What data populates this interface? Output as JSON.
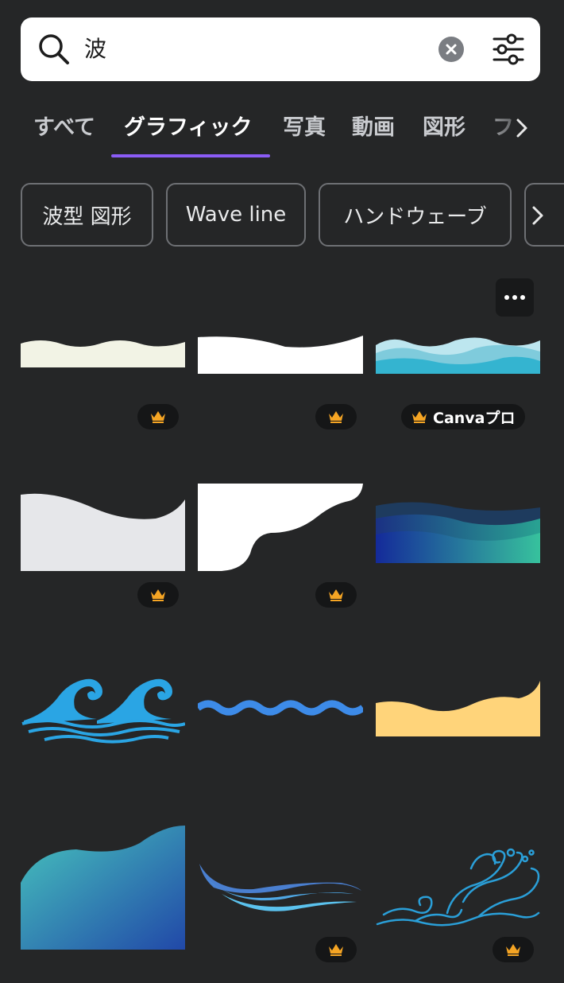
{
  "search": {
    "query": "波",
    "icons": {
      "search": "search-icon",
      "clear": "clear-icon",
      "filter": "filter-sliders-icon"
    }
  },
  "tabs": [
    {
      "label": "すべて",
      "active": false
    },
    {
      "label": "グラフィック",
      "active": true
    },
    {
      "label": "写真",
      "active": false
    },
    {
      "label": "動画",
      "active": false
    },
    {
      "label": "図形",
      "active": false
    },
    {
      "label": "フ",
      "active": false
    }
  ],
  "chips": [
    {
      "label": "波型 図形"
    },
    {
      "label": "Wave line"
    },
    {
      "label": "ハンドウェーブ"
    }
  ],
  "results": [
    {
      "name": "cream-wave-border",
      "badge": "crown"
    },
    {
      "name": "white-curve-banner",
      "badge": "crown"
    },
    {
      "name": "blue-layered-waves",
      "badge": "pro",
      "badge_label": "Canvaプロ"
    },
    {
      "name": "gray-wave-shape",
      "badge": "crown"
    },
    {
      "name": "white-cloud-corner",
      "badge": "crown"
    },
    {
      "name": "teal-gradient-waves",
      "badge": "none"
    },
    {
      "name": "blue-japanese-waves",
      "badge": "none"
    },
    {
      "name": "blue-zigzag-line",
      "badge": "none"
    },
    {
      "name": "yellow-wave-shape",
      "badge": "none"
    },
    {
      "name": "teal-blue-gradient-wave",
      "badge": "none"
    },
    {
      "name": "blue-swoosh-lines",
      "badge": "crown"
    },
    {
      "name": "blue-line-art-wave",
      "badge": "crown"
    }
  ],
  "colors": {
    "background": "#252627",
    "accent": "#8b5cf6",
    "crown": "#f5a524"
  }
}
